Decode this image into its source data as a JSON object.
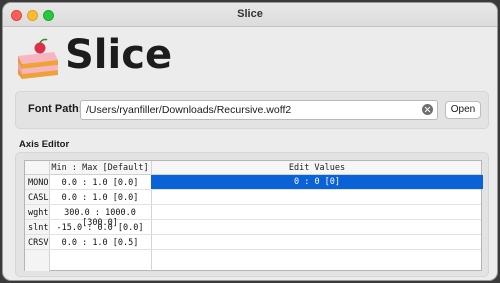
{
  "window": {
    "title": "Slice"
  },
  "logo": {
    "text": "Slice",
    "icon": "cake-slice-icon"
  },
  "font_path": {
    "label": "Font Path:",
    "value": "/Users/ryanfiller/Downloads/Recursive.woff2",
    "open_label": "Open"
  },
  "axis_editor": {
    "title": "Axis Editor",
    "headers": {
      "minmax": "Min : Max [Default]",
      "edit": "Edit Values"
    },
    "rows": [
      {
        "tag": "MONO",
        "minmax": "0.0 : 1.0 [0.0]",
        "edit": "0 : 0 [0]",
        "selected": true
      },
      {
        "tag": "CASL",
        "minmax": "0.0 : 1.0 [0.0]",
        "edit": "",
        "selected": false
      },
      {
        "tag": "wght",
        "minmax": "300.0 : 1000.0 [300.0]",
        "edit": "",
        "selected": false
      },
      {
        "tag": "slnt",
        "minmax": "-15.0 : 0.0 [0.0]",
        "edit": "",
        "selected": false
      },
      {
        "tag": "CRSV",
        "minmax": "0.0 : 1.0 [0.5]",
        "edit": "",
        "selected": false
      }
    ]
  },
  "colors": {
    "selection": "#0a63d6",
    "close": "#fe5f57",
    "minimize": "#febc2e",
    "maximize": "#28c840"
  }
}
